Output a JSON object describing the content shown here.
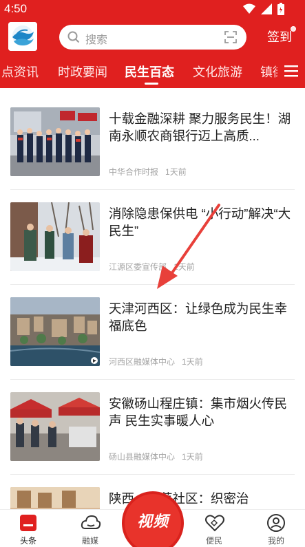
{
  "status_bar": {
    "time": "4:50"
  },
  "header": {
    "search_placeholder": "搜索",
    "signin_label": "签到"
  },
  "tabs": [
    {
      "label": "点资讯"
    },
    {
      "label": "时政要闻"
    },
    {
      "label": "民生百态",
      "active": true
    },
    {
      "label": "文化旅游"
    },
    {
      "label": "镇街"
    }
  ],
  "articles": [
    {
      "title": "十载金融深耕 聚力服务民生！湖南永顺农商银行迈上高质...",
      "source": "中华合作时报",
      "time": "1天前"
    },
    {
      "title": "消除隐患保供电 “小行动”解决“大民生”",
      "source": "江源区委宣传部",
      "time": "1天前"
    },
    {
      "title": "天津河西区：让绿色成为民生幸福底色",
      "source": "河西区融媒体中心",
      "time": "1天前"
    },
    {
      "title": "安徽砀山程庄镇：集市烟火传民声 民生实事暖人心",
      "source": "砀山县融媒体中心",
      "time": "1天前"
    },
    {
      "title": "陕西…古莘社区：织密治",
      "source": "",
      "time": ""
    }
  ],
  "bottom_nav": [
    {
      "label": "头条",
      "icon": "headline-icon",
      "active": true
    },
    {
      "label": "融媒",
      "icon": "cloud-icon"
    },
    {
      "label": "视频",
      "icon": "video-icon"
    },
    {
      "label": "便民",
      "icon": "heart-hands-icon"
    },
    {
      "label": "我的",
      "icon": "user-icon"
    }
  ],
  "colors": {
    "brand_red": "#e0201f",
    "arrow": "#e8403a"
  }
}
